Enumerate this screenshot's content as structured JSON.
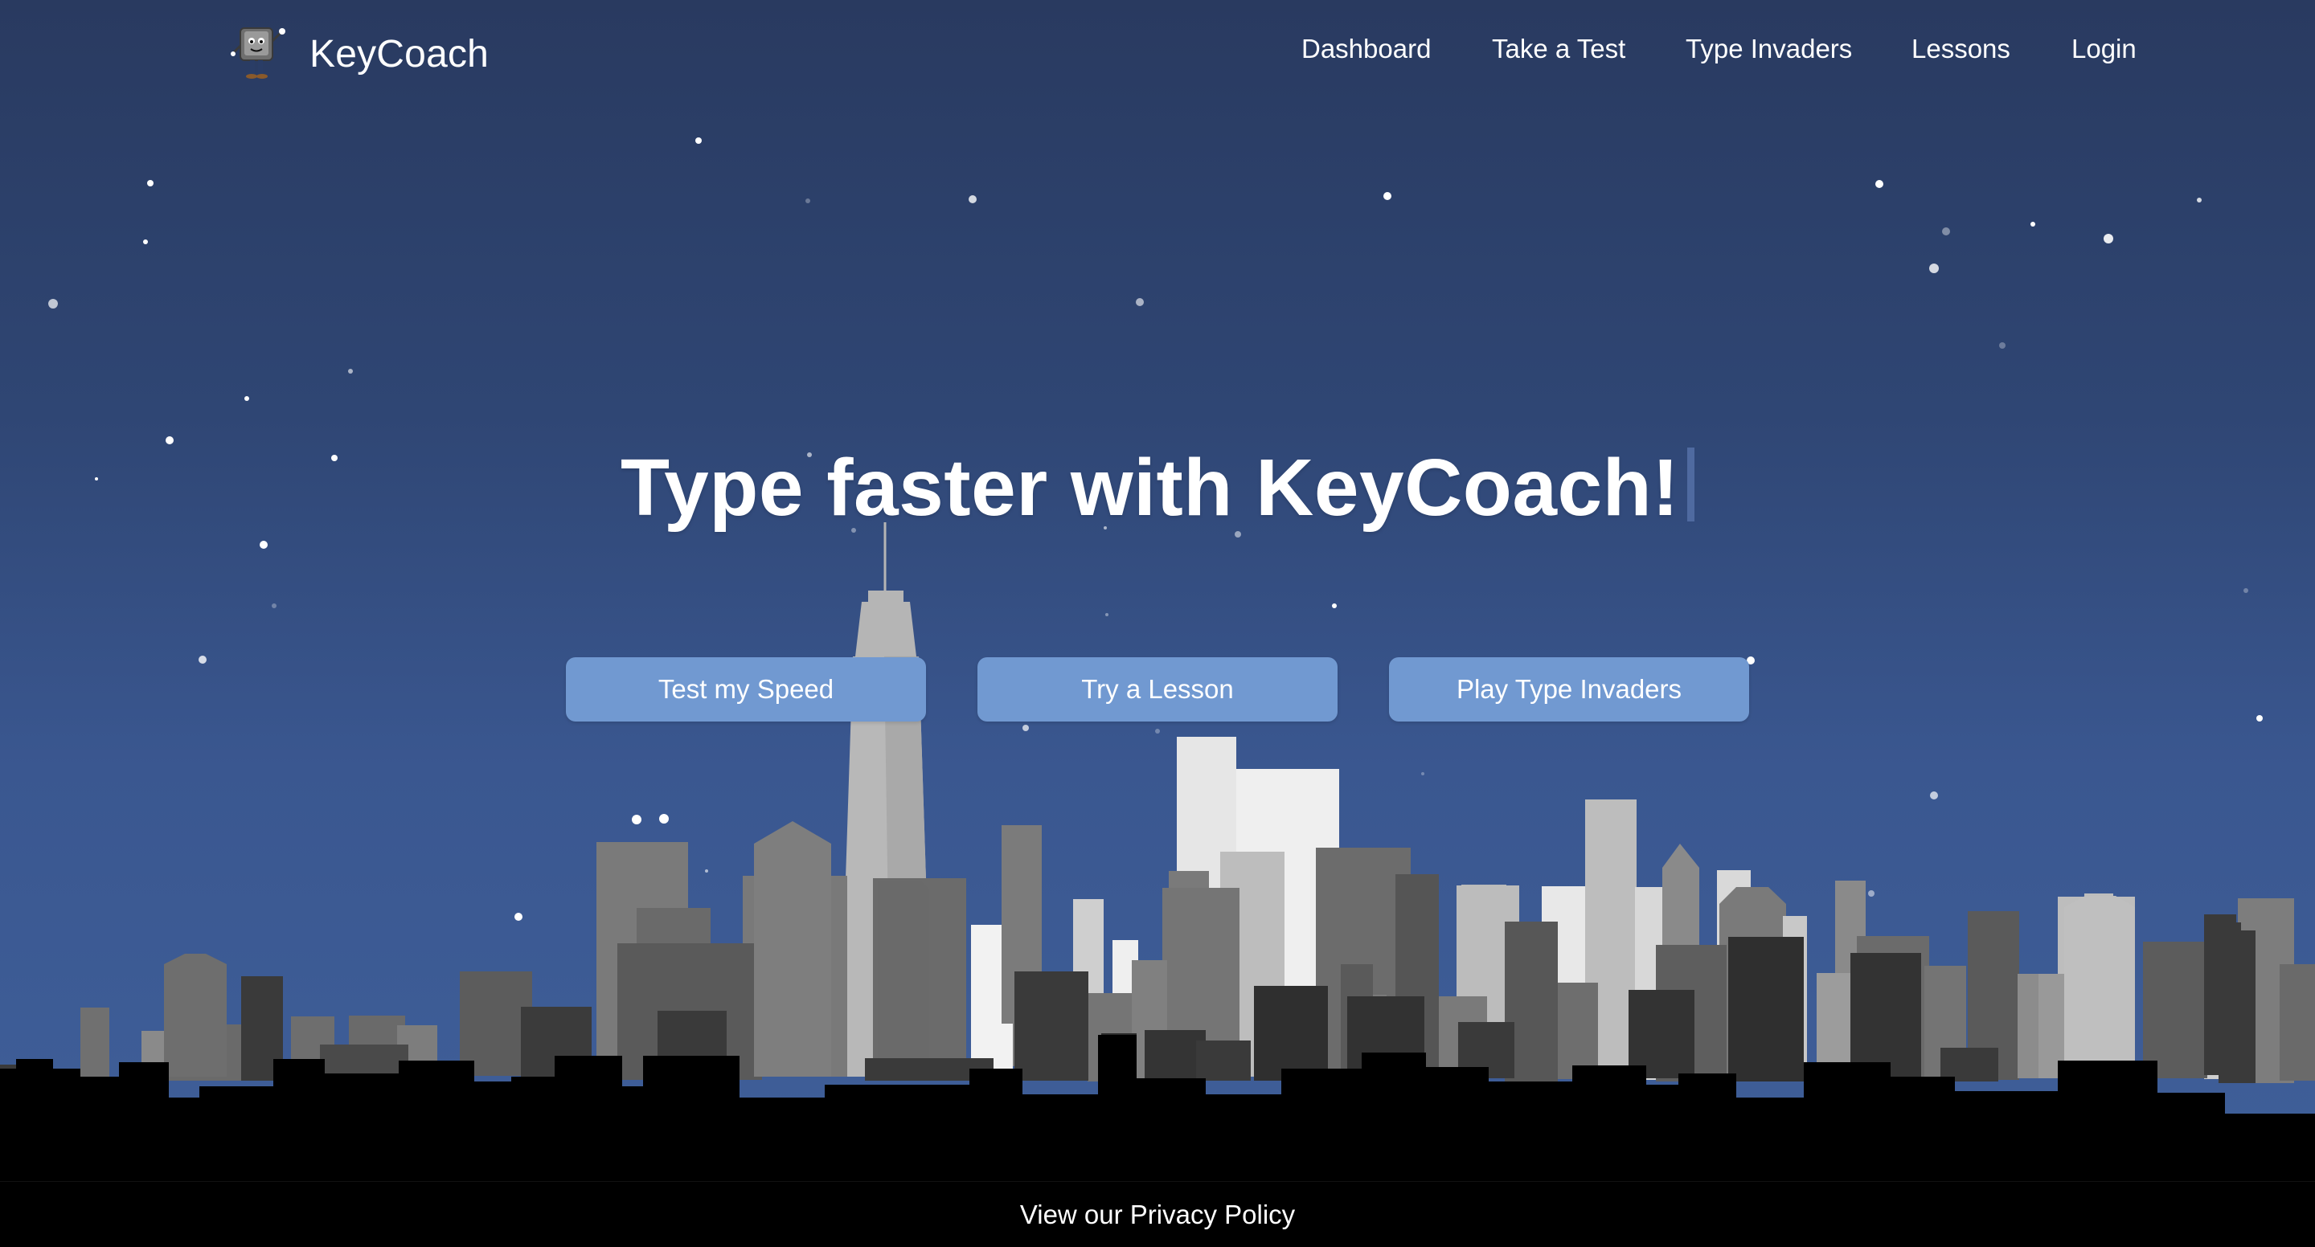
{
  "brand": {
    "name": "KeyCoach",
    "logo_icon": "keyboard-key-mascot-icon"
  },
  "nav": {
    "items": [
      {
        "label": "Dashboard"
      },
      {
        "label": "Take a Test"
      },
      {
        "label": "Type Invaders"
      },
      {
        "label": "Lessons"
      },
      {
        "label": "Login"
      }
    ]
  },
  "hero": {
    "title": "Type faster with KeyCoach!",
    "buttons": [
      {
        "label": "Test my Speed"
      },
      {
        "label": "Try a Lesson"
      },
      {
        "label": "Play Type Invaders"
      }
    ]
  },
  "footer": {
    "privacy_link": "View our Privacy Policy"
  },
  "colors": {
    "sky_top": "#293a60",
    "sky_bottom": "#3f5f99",
    "button": "#7199d1",
    "caret": "#4f6aa0",
    "ground": "#000000"
  }
}
